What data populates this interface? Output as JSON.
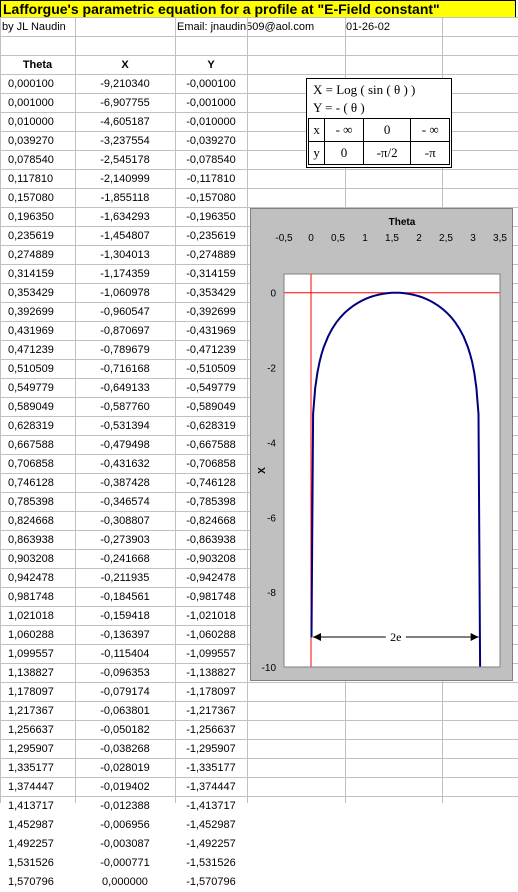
{
  "title": "Lafforgue's parametric equation for a profile at \"E-Field constant\"",
  "info": {
    "author": "by JL Naudin",
    "email": "Email: jnaudin509@aol.com",
    "date": "01-26-02"
  },
  "headers": [
    "Theta",
    "X",
    "Y"
  ],
  "rows": [
    [
      "0,000100",
      "-9,210340",
      "-0,000100"
    ],
    [
      "0,001000",
      "-6,907755",
      "-0,001000"
    ],
    [
      "0,010000",
      "-4,605187",
      "-0,010000"
    ],
    [
      "0,039270",
      "-3,237554",
      "-0,039270"
    ],
    [
      "0,078540",
      "-2,545178",
      "-0,078540"
    ],
    [
      "0,117810",
      "-2,140999",
      "-0,117810"
    ],
    [
      "0,157080",
      "-1,855118",
      "-0,157080"
    ],
    [
      "0,196350",
      "-1,634293",
      "-0,196350"
    ],
    [
      "0,235619",
      "-1,454807",
      "-0,235619"
    ],
    [
      "0,274889",
      "-1,304013",
      "-0,274889"
    ],
    [
      "0,314159",
      "-1,174359",
      "-0,314159"
    ],
    [
      "0,353429",
      "-1,060978",
      "-0,353429"
    ],
    [
      "0,392699",
      "-0,960547",
      "-0,392699"
    ],
    [
      "0,431969",
      "-0,870697",
      "-0,431969"
    ],
    [
      "0,471239",
      "-0,789679",
      "-0,471239"
    ],
    [
      "0,510509",
      "-0,716168",
      "-0,510509"
    ],
    [
      "0,549779",
      "-0,649133",
      "-0,549779"
    ],
    [
      "0,589049",
      "-0,587760",
      "-0,589049"
    ],
    [
      "0,628319",
      "-0,531394",
      "-0,628319"
    ],
    [
      "0,667588",
      "-0,479498",
      "-0,667588"
    ],
    [
      "0,706858",
      "-0,431632",
      "-0,706858"
    ],
    [
      "0,746128",
      "-0,387428",
      "-0,746128"
    ],
    [
      "0,785398",
      "-0,346574",
      "-0,785398"
    ],
    [
      "0,824668",
      "-0,308807",
      "-0,824668"
    ],
    [
      "0,863938",
      "-0,273903",
      "-0,863938"
    ],
    [
      "0,903208",
      "-0,241668",
      "-0,903208"
    ],
    [
      "0,942478",
      "-0,211935",
      "-0,942478"
    ],
    [
      "0,981748",
      "-0,184561",
      "-0,981748"
    ],
    [
      "1,021018",
      "-0,159418",
      "-1,021018"
    ],
    [
      "1,060288",
      "-0,136397",
      "-1,060288"
    ],
    [
      "1,099557",
      "-0,115404",
      "-1,099557"
    ],
    [
      "1,138827",
      "-0,096353",
      "-1,138827"
    ],
    [
      "1,178097",
      "-0,079174",
      "-1,178097"
    ],
    [
      "1,217367",
      "-0,063801",
      "-1,217367"
    ],
    [
      "1,256637",
      "-0,050182",
      "-1,256637"
    ],
    [
      "1,295907",
      "-0,038268",
      "-1,295907"
    ],
    [
      "1,335177",
      "-0,028019",
      "-1,335177"
    ],
    [
      "1,374447",
      "-0,019402",
      "-1,374447"
    ],
    [
      "1,413717",
      "-0,012388",
      "-1,413717"
    ],
    [
      "1,452987",
      "-0,006956",
      "-1,452987"
    ],
    [
      "1,492257",
      "-0,003087",
      "-1,492257"
    ],
    [
      "1,531526",
      "-0,000771",
      "-1,531526"
    ],
    [
      "1,570796",
      "0,000000",
      "-1,570796"
    ]
  ],
  "formula": {
    "line1": "X = Log ( sin ( θ ) )",
    "line2": "Y = - ( θ )",
    "table": [
      [
        "x",
        "- ∞",
        "0",
        "- ∞"
      ],
      [
        "y",
        "0",
        "-π/2",
        "-π"
      ]
    ]
  },
  "chart_data": {
    "type": "line",
    "title": "Theta",
    "xlabel": "",
    "ylabel": "X",
    "xlim": [
      -0.5,
      3.5
    ],
    "ylim": [
      -10,
      0.5
    ],
    "x_ticks": [
      "-0,5",
      "0",
      "0,5",
      "1",
      "1,5",
      "2",
      "2,5",
      "3",
      "3,5"
    ],
    "x_tick_values": [
      -0.5,
      0,
      0.5,
      1,
      1.5,
      2,
      2.5,
      3,
      3.5
    ],
    "y_ticks": [
      "0",
      "-2",
      "-4",
      "-6",
      "-8",
      "-10"
    ],
    "y_tick_values": [
      0,
      -2,
      -4,
      -6,
      -8,
      -10
    ],
    "series": [
      {
        "color": "#000080",
        "x": [
          0.01,
          0.03927,
          0.07854,
          0.11781,
          0.15708,
          0.19635,
          0.235619,
          0.314159,
          0.392699,
          0.471239,
          0.549779,
          0.628319,
          0.706858,
          0.785398,
          0.863938,
          0.942478,
          1.021018,
          1.099557,
          1.178097,
          1.256637,
          1.335177,
          1.413717,
          1.492257,
          1.570796,
          1.649336,
          1.727876,
          1.806416,
          1.884956,
          1.963495,
          2.042035,
          2.120575,
          2.199115,
          2.277655,
          2.356194,
          2.434734,
          2.513274,
          2.591814,
          2.670354,
          2.748894,
          2.827433,
          2.905973,
          2.945243,
          2.984513,
          3.023783,
          3.063053,
          3.102323,
          3.131593
        ],
        "y": [
          -9.21034,
          -3.237554,
          -2.545178,
          -2.140999,
          -1.855118,
          -1.634293,
          -1.454807,
          -1.174359,
          -0.960547,
          -0.789679,
          -0.649133,
          -0.531394,
          -0.431632,
          -0.346574,
          -0.273903,
          -0.211935,
          -0.159418,
          -0.115404,
          -0.079174,
          -0.050182,
          -0.028019,
          -0.012388,
          -0.003087,
          0,
          -0.003087,
          -0.012388,
          -0.028019,
          -0.050182,
          -0.079174,
          -0.115404,
          -0.159418,
          -0.211935,
          -0.273903,
          -0.346574,
          -0.431632,
          -0.531394,
          -0.649133,
          -0.789679,
          -0.960547,
          -1.174359,
          -1.454807,
          -1.634293,
          -1.855118,
          -2.140999,
          -2.545178,
          -3.237554,
          -10
        ]
      }
    ],
    "reference_lines": {
      "color": "#ff0000",
      "x": [
        0
      ],
      "y": [
        0
      ]
    },
    "annotation": "2e"
  }
}
